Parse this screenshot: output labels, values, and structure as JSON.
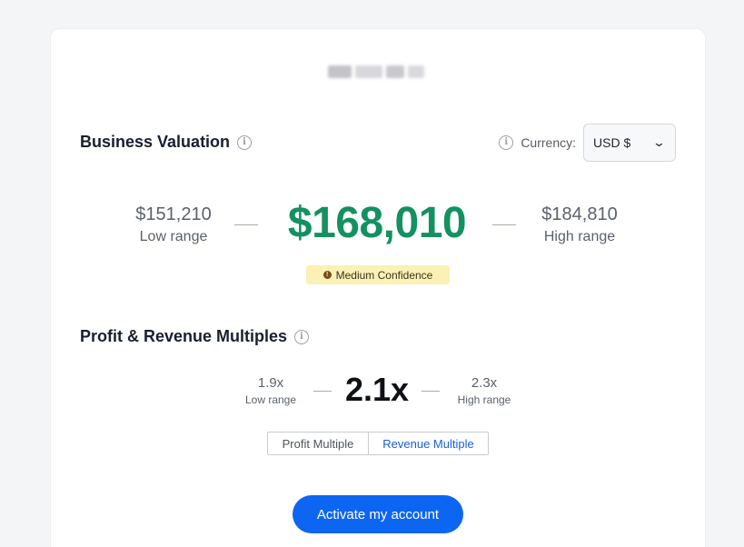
{
  "logo": {
    "alt": "",
    "blurred": true
  },
  "valuation": {
    "title": "Business Valuation",
    "info_icon": "info-icon",
    "currency_label": "Currency:",
    "currency_value": "USD $",
    "low_value": "$151,210",
    "low_label": "Low range",
    "main_value": "$168,010",
    "high_value": "$184,810",
    "high_label": "High range",
    "confidence": "Medium Confidence",
    "main_color": "#139160"
  },
  "multiples": {
    "title": "Profit & Revenue Multiples",
    "low_value": "1.9x",
    "low_label": "Low range",
    "main_value": "2.1x",
    "high_value": "2.3x",
    "high_label": "High range",
    "tabs": [
      "Profit Multiple",
      "Revenue Multiple"
    ],
    "active_tab": "Revenue Multiple"
  },
  "cta": {
    "label": "Activate my account",
    "color": "#0d66f2"
  }
}
